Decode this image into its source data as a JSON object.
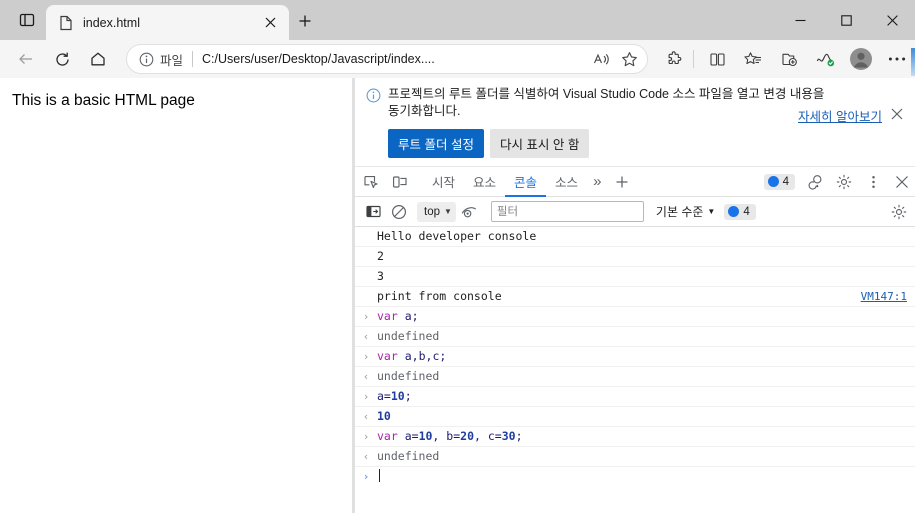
{
  "window": {
    "titlebar": {
      "tab_search_icon": "tab-search-icon",
      "minimize_label": "—",
      "maximize_label": "☐",
      "close_label": "✕"
    },
    "tab": {
      "title": "index.html",
      "favicon": "document-icon",
      "close_icon": "close-icon"
    },
    "new_tab_icon": "plus-icon"
  },
  "toolbar": {
    "back_icon": "back-arrow-icon",
    "reload_icon": "reload-icon",
    "home_icon": "home-icon",
    "omnibox": {
      "info_icon": "info-circle-icon",
      "scheme_label": "파일",
      "url": "C:/Users/user/Desktop/Javascript/index....",
      "read_aloud_icon": "read-aloud-icon",
      "favorite_icon": "star-icon"
    },
    "right_icons": [
      {
        "name": "extensions-icon"
      },
      {
        "name": "split-screen-icon"
      },
      {
        "name": "collections-icon"
      },
      {
        "name": "add-to-collection-icon"
      },
      {
        "name": "browser-essentials-icon"
      },
      {
        "name": "profile-avatar-icon"
      },
      {
        "name": "settings-and-more-icon"
      }
    ]
  },
  "page": {
    "heading": "This is a basic HTML page"
  },
  "devtools": {
    "notification": {
      "info_icon": "info-circle-icon",
      "message": "프로젝트의 루트 폴더를 식별하여 Visual Studio Code 소스 파일을 열고 변경 내용을 동기화합니다.",
      "learn_more": "자세히 알아보기",
      "close_icon": "close-icon",
      "primary_button": "루트 폴더 설정",
      "secondary_button": "다시 표시 안 함"
    },
    "tabbar": {
      "inspect_icon": "inspect-element-icon",
      "device_toolbar_icon": "device-toolbar-icon",
      "tabs": [
        {
          "label": "시작",
          "active": false
        },
        {
          "label": "요소",
          "active": false
        },
        {
          "label": "콘솔",
          "active": true
        },
        {
          "label": "소스",
          "active": false
        }
      ],
      "more_tabs_icon": "»",
      "add_tab_icon": "plus-icon",
      "message_count": "4",
      "feedback_icon": "feedback-icon",
      "settings_icon": "gear-icon",
      "kebab_icon": "more-options-icon",
      "close_icon": "close-icon"
    },
    "console_toolbar": {
      "sidebar_icon": "console-sidebar-icon",
      "clear_icon": "clear-console-icon",
      "context_label": "top",
      "context_caret": "▼",
      "eye_icon": "live-expression-icon",
      "filter_placeholder": "필터",
      "filter_value": "",
      "level_label": "기본 수준",
      "level_caret": "▼",
      "issue_count": "4",
      "settings_icon": "gear-icon"
    },
    "console_rows": [
      {
        "kind": "log",
        "gutter": "",
        "text": "Hello developer console",
        "source": ""
      },
      {
        "kind": "log",
        "gutter": "",
        "text": "2",
        "source": ""
      },
      {
        "kind": "log",
        "gutter": "",
        "text": "3",
        "source": ""
      },
      {
        "kind": "log",
        "gutter": "",
        "text": "print from console",
        "source": "VM147:1"
      },
      {
        "kind": "input",
        "gutter": "›",
        "text": "var a;",
        "source": ""
      },
      {
        "kind": "output",
        "gutter": "‹",
        "text": "undefined",
        "source": ""
      },
      {
        "kind": "input",
        "gutter": "›",
        "text": "var a,b,c;",
        "source": ""
      },
      {
        "kind": "output",
        "gutter": "‹",
        "text": "undefined",
        "source": ""
      },
      {
        "kind": "input",
        "gutter": "›",
        "text": "a=10;",
        "source": ""
      },
      {
        "kind": "output-num",
        "gutter": "‹",
        "text": "10",
        "source": ""
      },
      {
        "kind": "input",
        "gutter": "›",
        "text": "var a=10, b=20, c=30;",
        "source": ""
      },
      {
        "kind": "output",
        "gutter": "‹",
        "text": "undefined",
        "source": ""
      },
      {
        "kind": "prompt",
        "gutter": "›",
        "text": "",
        "source": ""
      }
    ],
    "colors": {
      "accent": "#1a73e8",
      "link": "#1a5fb4",
      "primary_button": "#0a66c2",
      "keyword": "#a626a4",
      "number": "#1f3da1",
      "muted": "#5f6368"
    }
  }
}
